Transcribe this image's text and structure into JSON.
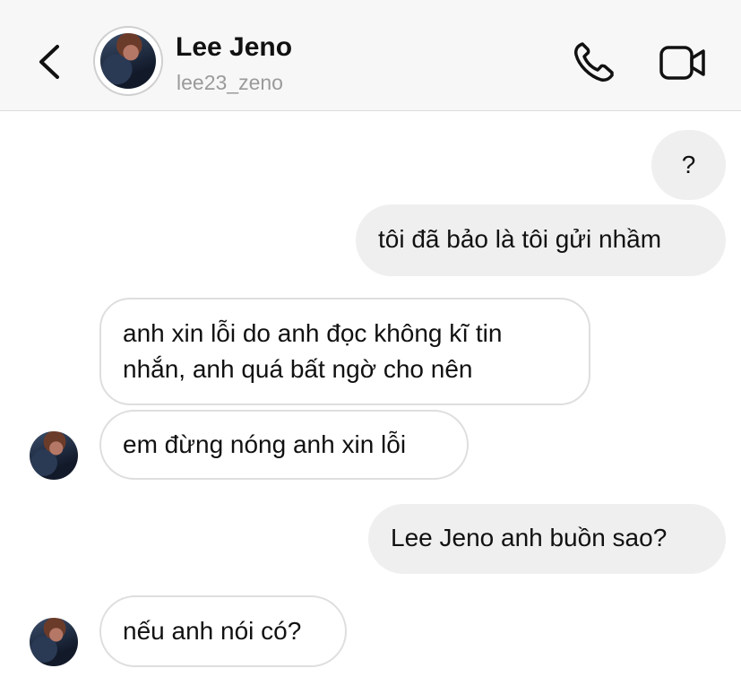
{
  "header": {
    "name": "Lee Jeno",
    "username": "lee23_zeno",
    "icons": {
      "back": "chevron-left-icon",
      "call": "phone-icon",
      "video": "video-camera-icon"
    }
  },
  "messages": [
    {
      "from": "me",
      "text": "?"
    },
    {
      "from": "me",
      "text": "tôi đã bảo là tôi gửi nhầm"
    },
    {
      "from": "them",
      "lines": [
        "anh xin lỗi do anh đọc không kĩ tin",
        "nhắn, anh quá bất ngờ cho nên"
      ]
    },
    {
      "from": "them",
      "text": "em đừng nóng anh xin lỗi"
    },
    {
      "from": "me",
      "text": "Lee Jeno anh buồn sao?"
    },
    {
      "from": "them",
      "text": "nếu anh nói có?"
    }
  ]
}
